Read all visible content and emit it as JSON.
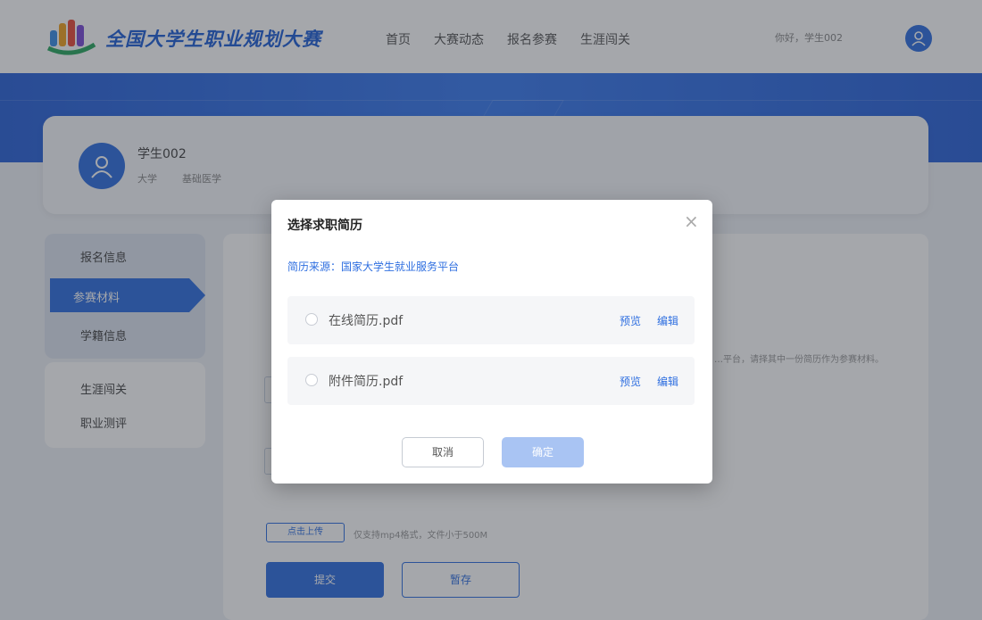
{
  "header": {
    "brand": "全国大学生职业规划大赛",
    "nav": [
      "首页",
      "大赛动态",
      "报名参赛",
      "生涯闯关"
    ],
    "greeting": "你好，学生002"
  },
  "profile": {
    "name": "学生002",
    "school": "大学",
    "major": "基础医学"
  },
  "sidebar": {
    "items": [
      "报名信息",
      "参赛材料",
      "学籍信息",
      "生涯闯关",
      "职业测评"
    ]
  },
  "main": {
    "note": "…平台，请择其中一份简历作为参赛材料。",
    "upload_button": "点击上传",
    "upload_hint": "仅支持mp4格式，文件小于500M",
    "submit_button": "提交",
    "save_button": "暂存"
  },
  "modal": {
    "title": "选择求职简历",
    "source": "简历来源：国家大学生就业服务平台",
    "resumes": [
      {
        "name": "在线简历.pdf",
        "preview": "预览",
        "edit": "编辑"
      },
      {
        "name": "附件简历.pdf",
        "preview": "预览",
        "edit": "编辑"
      }
    ],
    "cancel": "取消",
    "confirm": "确定"
  },
  "colors": {
    "primary": "#2f6fe0",
    "confirm_disabled": "#a9c4f3"
  }
}
